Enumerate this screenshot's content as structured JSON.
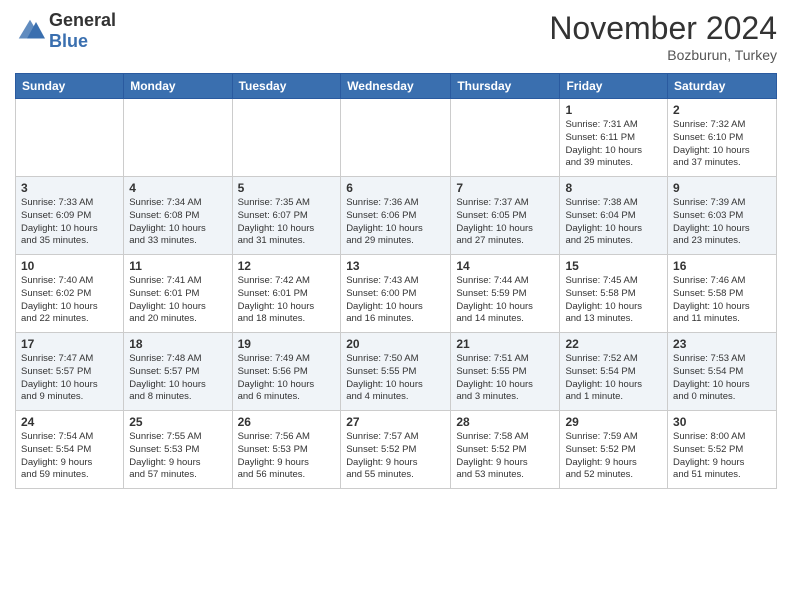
{
  "logo": {
    "general": "General",
    "blue": "Blue"
  },
  "header": {
    "month": "November 2024",
    "location": "Bozburun, Turkey"
  },
  "weekdays": [
    "Sunday",
    "Monday",
    "Tuesday",
    "Wednesday",
    "Thursday",
    "Friday",
    "Saturday"
  ],
  "weeks": [
    [
      {
        "day": "",
        "info": ""
      },
      {
        "day": "",
        "info": ""
      },
      {
        "day": "",
        "info": ""
      },
      {
        "day": "",
        "info": ""
      },
      {
        "day": "",
        "info": ""
      },
      {
        "day": "1",
        "info": "Sunrise: 7:31 AM\nSunset: 6:11 PM\nDaylight: 10 hours\nand 39 minutes."
      },
      {
        "day": "2",
        "info": "Sunrise: 7:32 AM\nSunset: 6:10 PM\nDaylight: 10 hours\nand 37 minutes."
      }
    ],
    [
      {
        "day": "3",
        "info": "Sunrise: 7:33 AM\nSunset: 6:09 PM\nDaylight: 10 hours\nand 35 minutes."
      },
      {
        "day": "4",
        "info": "Sunrise: 7:34 AM\nSunset: 6:08 PM\nDaylight: 10 hours\nand 33 minutes."
      },
      {
        "day": "5",
        "info": "Sunrise: 7:35 AM\nSunset: 6:07 PM\nDaylight: 10 hours\nand 31 minutes."
      },
      {
        "day": "6",
        "info": "Sunrise: 7:36 AM\nSunset: 6:06 PM\nDaylight: 10 hours\nand 29 minutes."
      },
      {
        "day": "7",
        "info": "Sunrise: 7:37 AM\nSunset: 6:05 PM\nDaylight: 10 hours\nand 27 minutes."
      },
      {
        "day": "8",
        "info": "Sunrise: 7:38 AM\nSunset: 6:04 PM\nDaylight: 10 hours\nand 25 minutes."
      },
      {
        "day": "9",
        "info": "Sunrise: 7:39 AM\nSunset: 6:03 PM\nDaylight: 10 hours\nand 23 minutes."
      }
    ],
    [
      {
        "day": "10",
        "info": "Sunrise: 7:40 AM\nSunset: 6:02 PM\nDaylight: 10 hours\nand 22 minutes."
      },
      {
        "day": "11",
        "info": "Sunrise: 7:41 AM\nSunset: 6:01 PM\nDaylight: 10 hours\nand 20 minutes."
      },
      {
        "day": "12",
        "info": "Sunrise: 7:42 AM\nSunset: 6:01 PM\nDaylight: 10 hours\nand 18 minutes."
      },
      {
        "day": "13",
        "info": "Sunrise: 7:43 AM\nSunset: 6:00 PM\nDaylight: 10 hours\nand 16 minutes."
      },
      {
        "day": "14",
        "info": "Sunrise: 7:44 AM\nSunset: 5:59 PM\nDaylight: 10 hours\nand 14 minutes."
      },
      {
        "day": "15",
        "info": "Sunrise: 7:45 AM\nSunset: 5:58 PM\nDaylight: 10 hours\nand 13 minutes."
      },
      {
        "day": "16",
        "info": "Sunrise: 7:46 AM\nSunset: 5:58 PM\nDaylight: 10 hours\nand 11 minutes."
      }
    ],
    [
      {
        "day": "17",
        "info": "Sunrise: 7:47 AM\nSunset: 5:57 PM\nDaylight: 10 hours\nand 9 minutes."
      },
      {
        "day": "18",
        "info": "Sunrise: 7:48 AM\nSunset: 5:57 PM\nDaylight: 10 hours\nand 8 minutes."
      },
      {
        "day": "19",
        "info": "Sunrise: 7:49 AM\nSunset: 5:56 PM\nDaylight: 10 hours\nand 6 minutes."
      },
      {
        "day": "20",
        "info": "Sunrise: 7:50 AM\nSunset: 5:55 PM\nDaylight: 10 hours\nand 4 minutes."
      },
      {
        "day": "21",
        "info": "Sunrise: 7:51 AM\nSunset: 5:55 PM\nDaylight: 10 hours\nand 3 minutes."
      },
      {
        "day": "22",
        "info": "Sunrise: 7:52 AM\nSunset: 5:54 PM\nDaylight: 10 hours\nand 1 minute."
      },
      {
        "day": "23",
        "info": "Sunrise: 7:53 AM\nSunset: 5:54 PM\nDaylight: 10 hours\nand 0 minutes."
      }
    ],
    [
      {
        "day": "24",
        "info": "Sunrise: 7:54 AM\nSunset: 5:54 PM\nDaylight: 9 hours\nand 59 minutes."
      },
      {
        "day": "25",
        "info": "Sunrise: 7:55 AM\nSunset: 5:53 PM\nDaylight: 9 hours\nand 57 minutes."
      },
      {
        "day": "26",
        "info": "Sunrise: 7:56 AM\nSunset: 5:53 PM\nDaylight: 9 hours\nand 56 minutes."
      },
      {
        "day": "27",
        "info": "Sunrise: 7:57 AM\nSunset: 5:52 PM\nDaylight: 9 hours\nand 55 minutes."
      },
      {
        "day": "28",
        "info": "Sunrise: 7:58 AM\nSunset: 5:52 PM\nDaylight: 9 hours\nand 53 minutes."
      },
      {
        "day": "29",
        "info": "Sunrise: 7:59 AM\nSunset: 5:52 PM\nDaylight: 9 hours\nand 52 minutes."
      },
      {
        "day": "30",
        "info": "Sunrise: 8:00 AM\nSunset: 5:52 PM\nDaylight: 9 hours\nand 51 minutes."
      }
    ]
  ]
}
